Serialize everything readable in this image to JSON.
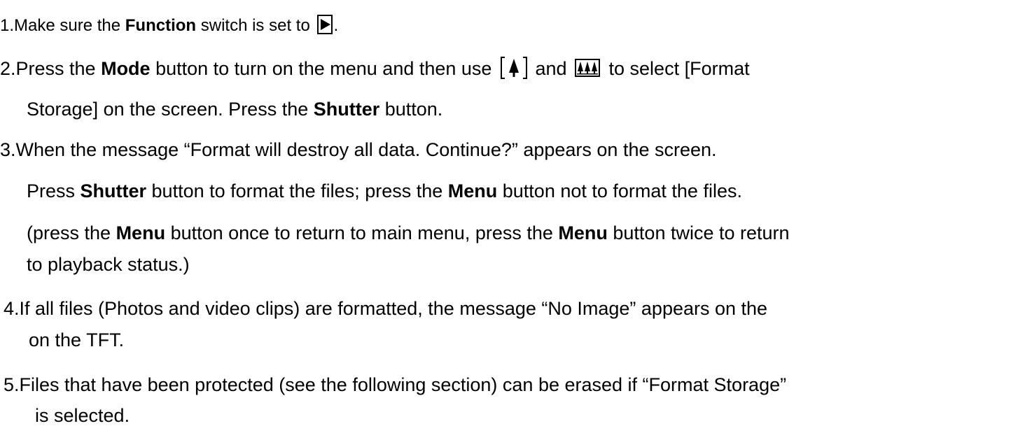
{
  "instructions": {
    "step1": {
      "prefix": "1.Make sure the ",
      "bold": "Function",
      "middle": " switch is set to ",
      "suffix": "."
    },
    "step2": {
      "prefix": "2.Press the ",
      "bold1": "Mode",
      "middle": " button to turn on the menu and then use ",
      "and": " and ",
      "tail": " to select [Format",
      "line2_prefix": "Storage] on the screen. Press the ",
      "bold2": "Shutter",
      "line2_suffix": " button."
    },
    "step3": {
      "line1": "3.When the message “Format will destroy all data. Continue?” appears on the screen.",
      "line2_prefix": "Press ",
      "bold1": "Shutter",
      "line2_middle": " button to format the files; press the ",
      "bold2": "Menu",
      "line2_suffix": " button not to format the files.",
      "line3_prefix": "(press the ",
      "bold3": "Menu",
      "line3_middle": " button once to return to main menu, press the ",
      "bold4": "Menu",
      "line3_suffix": " button twice to return",
      "line4": "to playback status.)"
    },
    "step4": {
      "line1": "4.If all files (Photos and video clips) are formatted, the message “No Image” appears on the",
      "line2": "on the TFT."
    },
    "step5": {
      "line1": "5.Files that have been protected (see the following section) can be erased if “Format Storage”",
      "line2": "is selected."
    }
  },
  "icons": {
    "play": "play-icon",
    "zoom_tele": "single-tree-icon",
    "zoom_wide": "three-trees-icon"
  }
}
